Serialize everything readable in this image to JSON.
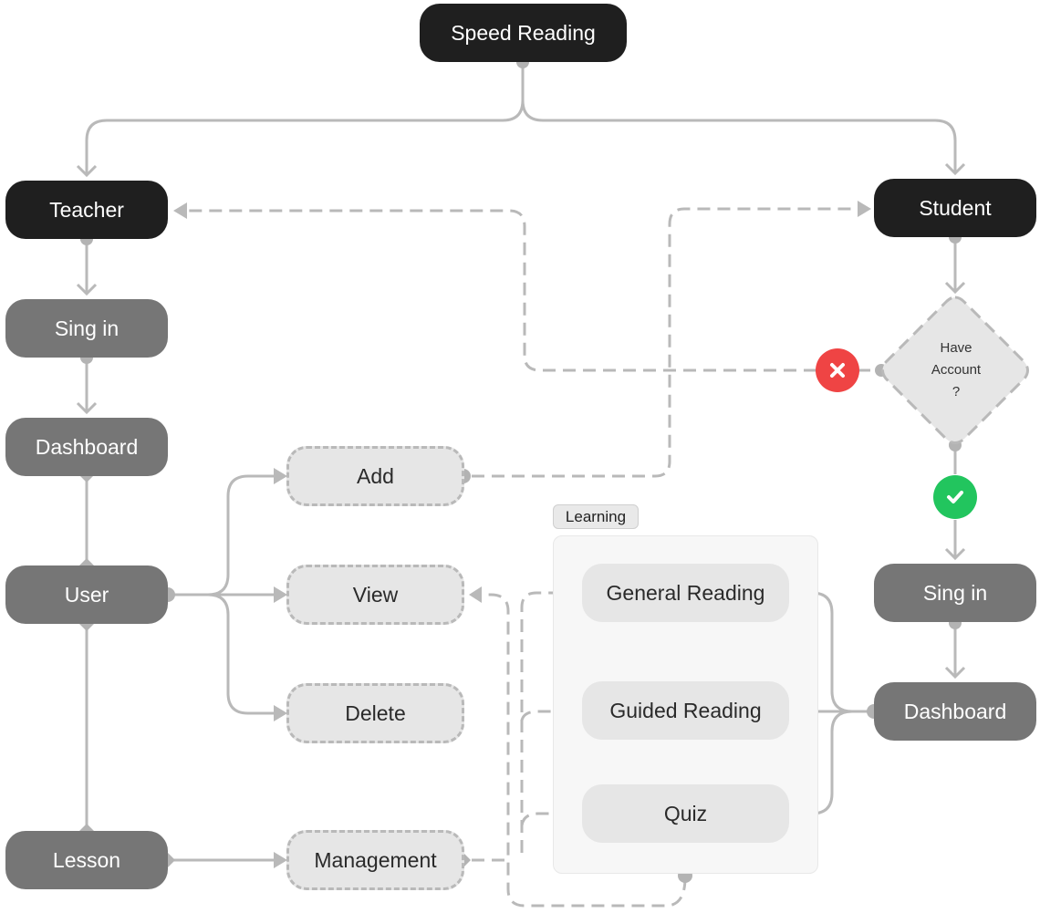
{
  "diagram": {
    "root": {
      "label": "Speed Reading"
    },
    "teacher_branch": {
      "role": "Teacher",
      "sign_in": "Sing in",
      "dashboard": "Dashboard",
      "user": "User",
      "lesson": "Lesson",
      "user_actions": [
        "Add",
        "View",
        "Delete"
      ],
      "lesson_action": "Management"
    },
    "student_branch": {
      "role": "Student",
      "decision": {
        "line1": "Have",
        "line2": "Account",
        "line3": "?"
      },
      "no_icon": "close-icon",
      "yes_icon": "check-icon",
      "sign_in": "Sing in",
      "dashboard": "Dashboard"
    },
    "learning_group": {
      "label": "Learning",
      "items": [
        "General Reading",
        "Guided Reading",
        "Quiz"
      ]
    },
    "colors": {
      "dark_node": "#1f1f1f",
      "mid_node": "#767676",
      "light_node": "#e6e6e6",
      "connector": "#b9b9b9",
      "no": "#ef4444",
      "yes": "#22c55e"
    }
  }
}
